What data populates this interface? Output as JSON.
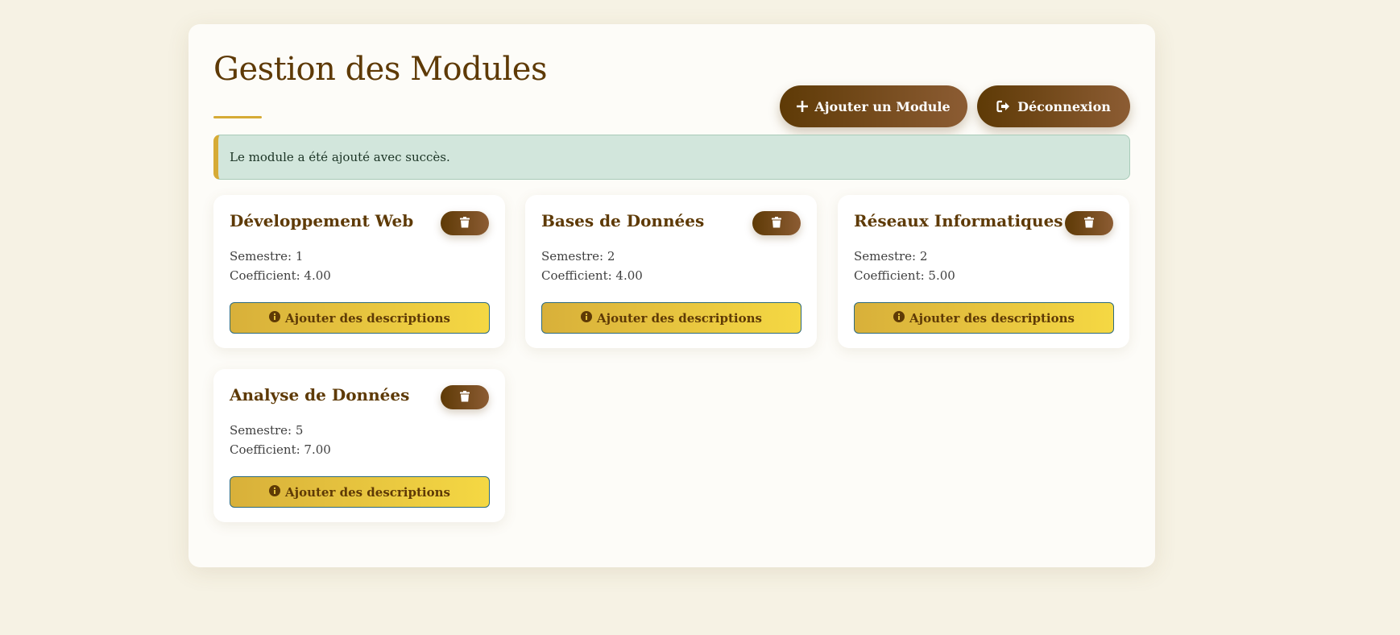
{
  "page": {
    "title": "Gestion des Modules"
  },
  "header": {
    "add_label": "Ajouter un Module",
    "logout_label": "Déconnexion"
  },
  "alert": {
    "message": "Le module a été ajouté avec succès."
  },
  "colors": {
    "brand_dark": "#5e3a06",
    "brand_light": "#8c5c33",
    "accent_gold": "#d6ab36",
    "success_bg": "#d2e6dc",
    "page_bg": "#f6f2e4"
  },
  "modules": [
    {
      "name": "Développement Web",
      "semestre": "Semestre: 1",
      "coefficient": "Coefficient: 4.00",
      "action_label": "Ajouter des descriptions"
    },
    {
      "name": "Bases de Données",
      "semestre": "Semestre: 2",
      "coefficient": "Coefficient: 4.00",
      "action_label": "Ajouter des descriptions"
    },
    {
      "name": "Réseaux Informatiques",
      "semestre": "Semestre: 2",
      "coefficient": "Coefficient: 5.00",
      "action_label": "Ajouter des descriptions"
    },
    {
      "name": "Analyse de Données",
      "semestre": "Semestre: 5",
      "coefficient": "Coefficient: 7.00",
      "action_label": "Ajouter des descriptions"
    }
  ],
  "icons": {
    "add": "plus-icon",
    "logout": "sign-out-icon",
    "delete": "trash-icon",
    "info": "info-circle-icon"
  }
}
